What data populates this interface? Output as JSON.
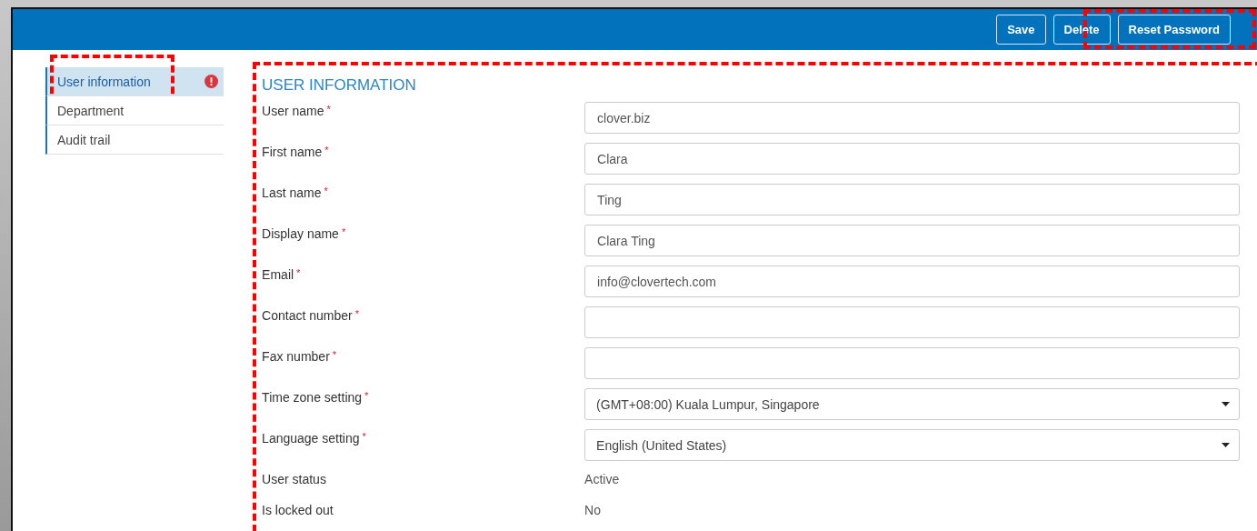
{
  "header": {
    "buttons": [
      {
        "label": "Save",
        "highlighted": false
      },
      {
        "label": "Delete",
        "highlighted": false
      },
      {
        "label": "Reset Password",
        "highlighted": true
      }
    ]
  },
  "sidebar": {
    "items": [
      {
        "label": "User information",
        "selected": true,
        "error": true,
        "highlighted": true
      },
      {
        "label": "Department",
        "selected": false,
        "error": false,
        "highlighted": false
      },
      {
        "label": "Audit trail",
        "selected": false,
        "error": false,
        "highlighted": false
      }
    ]
  },
  "form": {
    "title": "USER INFORMATION",
    "highlighted": true,
    "fields": [
      {
        "kind": "text",
        "label": "User name",
        "required_mark": "*",
        "value": "clover.biz"
      },
      {
        "kind": "text",
        "label": "First name",
        "required_mark": "*",
        "value": "Clara"
      },
      {
        "kind": "text",
        "label": "Last name",
        "required_mark": "*",
        "value": "Ting"
      },
      {
        "kind": "text",
        "label": "Display name",
        "required_mark": "*",
        "value": "Clara Ting"
      },
      {
        "kind": "text",
        "label": "Email",
        "required_mark": "*",
        "value": "info@clovertech.com"
      },
      {
        "kind": "text",
        "label": "Contact number",
        "required_mark": "*"
      },
      {
        "kind": "text",
        "label": "Fax number",
        "required_mark": "*"
      },
      {
        "kind": "select",
        "label": "Time zone setting",
        "required_mark": "*",
        "value": "(GMT+08:00) Kuala Lumpur, Singapore"
      },
      {
        "kind": "select",
        "label": "Language setting",
        "required_mark": "*",
        "value": "English (United States)"
      },
      {
        "kind": "static",
        "label": "User status",
        "value": "Active"
      },
      {
        "kind": "static",
        "label": "Is locked out",
        "value": "No"
      }
    ]
  }
}
